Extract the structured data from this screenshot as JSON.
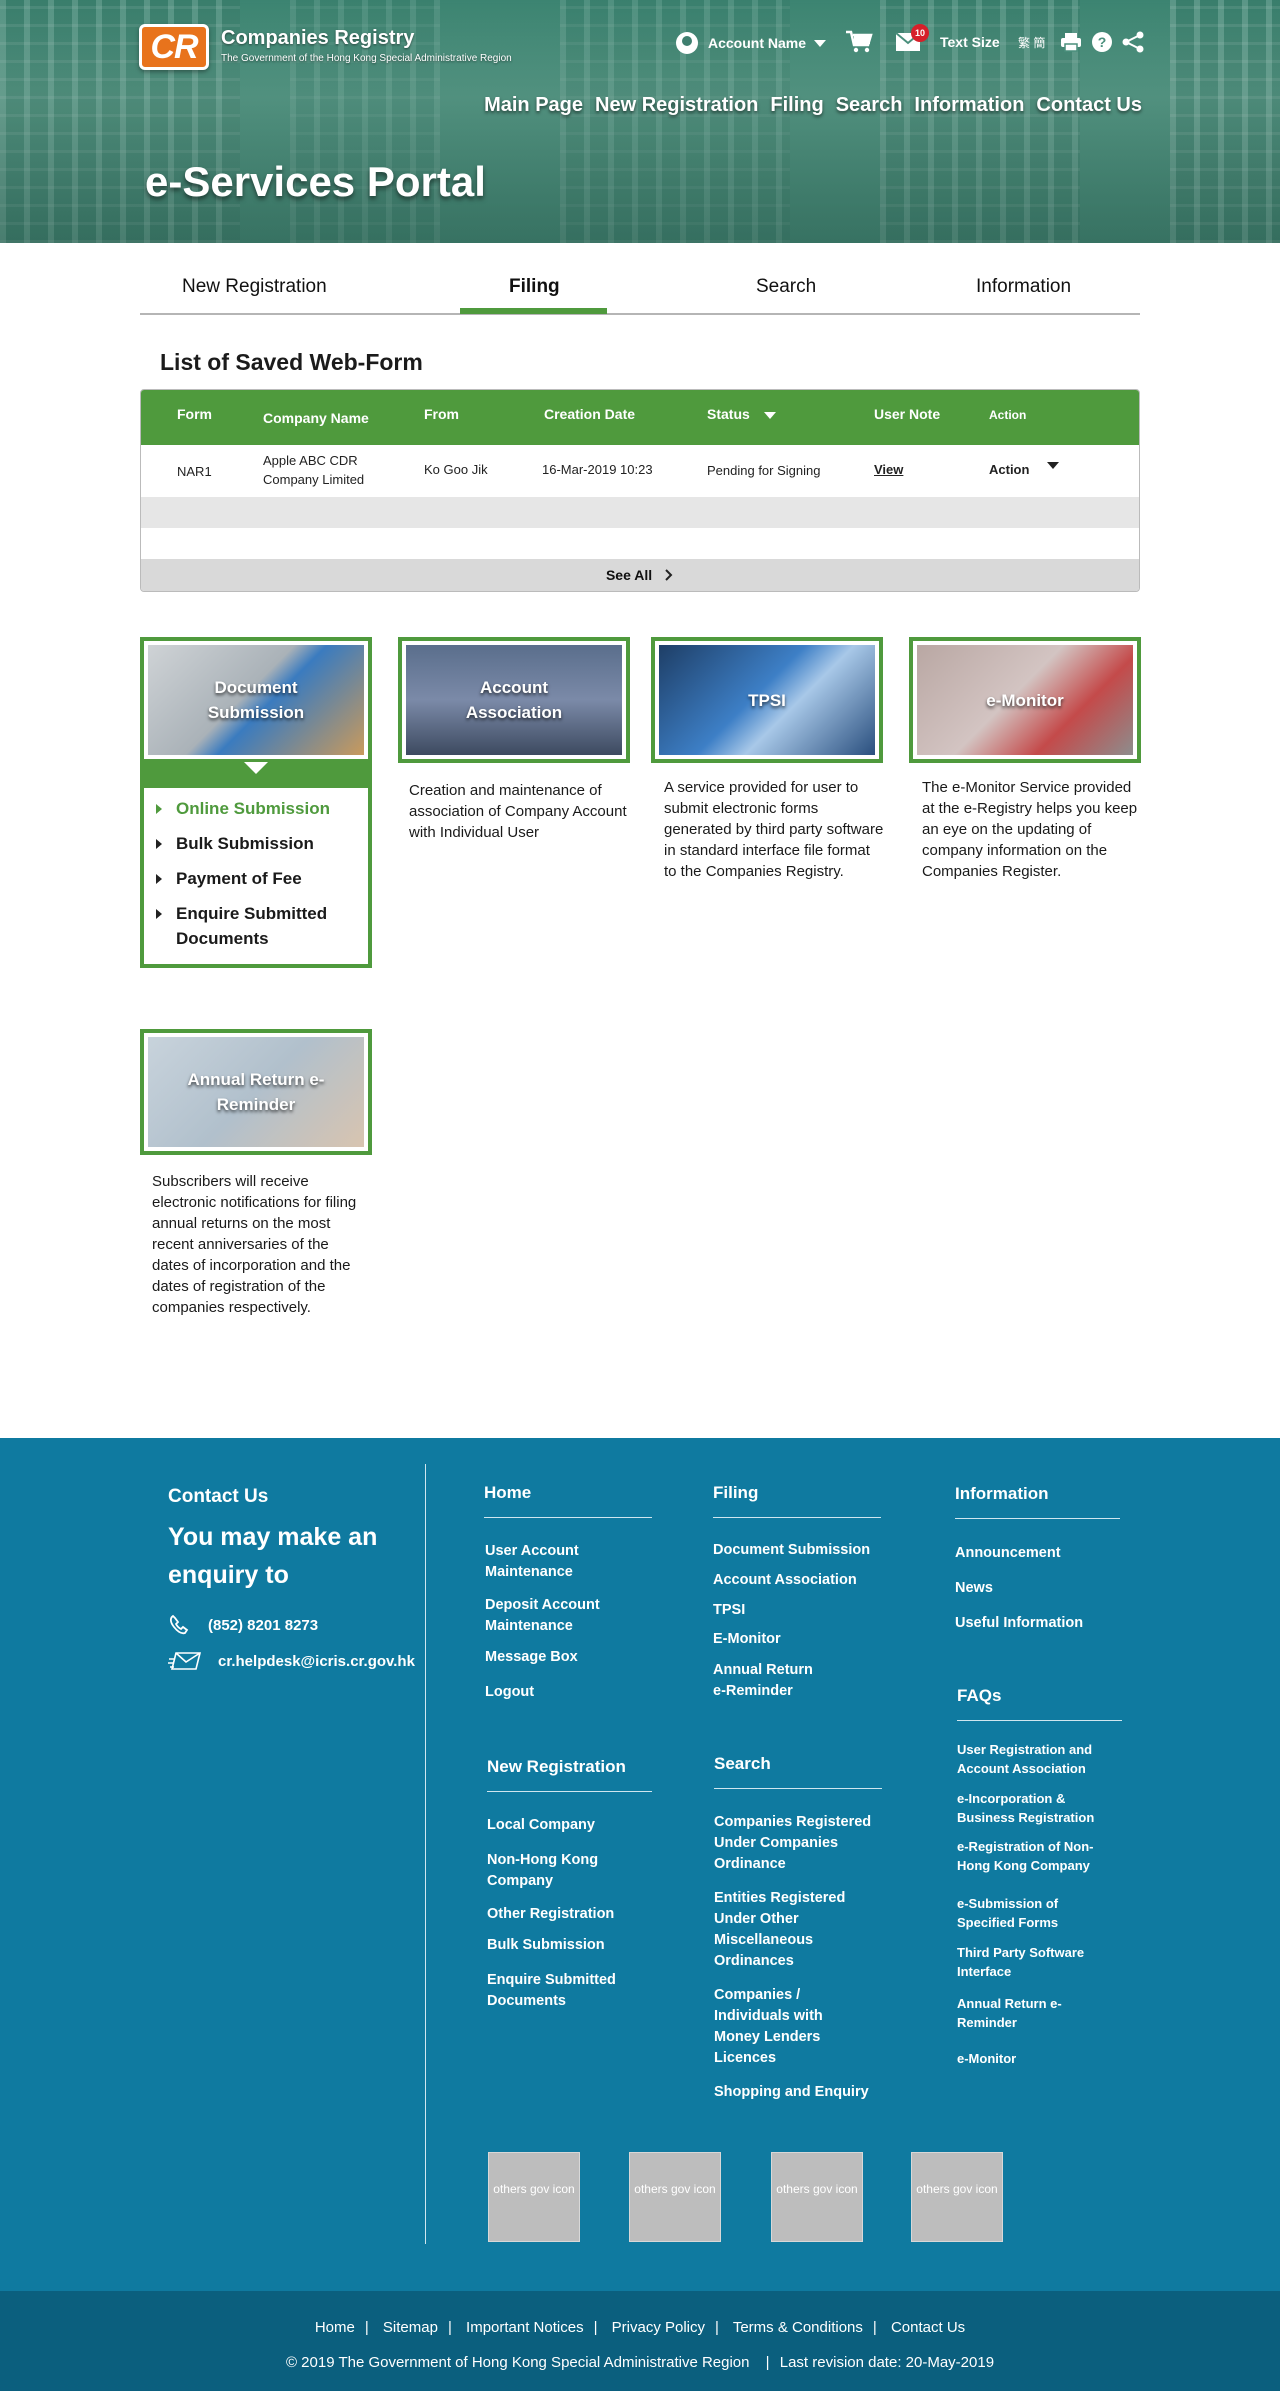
{
  "header": {
    "logo_mark": "CR",
    "org_name": "Companies Registry",
    "org_sub": "The Government of the Hong Kong Special Administrative Region",
    "account_name": "Account Name",
    "msg_count": "10",
    "text_size_label": "Text Size",
    "lang_label": "繁 簡",
    "page_title": "e-Services Portal"
  },
  "main_nav": [
    "Main Page",
    "New Registration",
    "Filing",
    "Search",
    "Information",
    "Contact Us"
  ],
  "tabs": {
    "items": [
      "New Registration",
      "Filing",
      "Search",
      "Information"
    ],
    "active": "Filing"
  },
  "saved_forms": {
    "title": "List of Saved Web-Form",
    "columns": [
      "Form",
      "Company Name",
      "From",
      "Creation Date",
      "Status",
      "User Note",
      "Action"
    ],
    "rows": [
      {
        "form": "NAR1",
        "company": "Apple ABC CDR Company Limited",
        "from": "Ko Goo Jik",
        "created": "16-Mar-2019 10:23",
        "status": "Pending for Signing",
        "note": "View",
        "action": "Action"
      }
    ],
    "see_all": "See All"
  },
  "services": {
    "doc_submission": {
      "title": "Document Submission",
      "menu": [
        "Online Submission",
        "Bulk Submission",
        "Payment of Fee",
        "Enquire Submitted Documents"
      ],
      "active_index": 0
    },
    "account_association": {
      "title": "Account Association",
      "desc": "Creation and maintenance of association of Company Account with Individual User"
    },
    "tpsi": {
      "title": "TPSI",
      "desc": "A service provided for user to submit electronic forms generated by third party software in standard interface file format to the Companies Registry."
    },
    "emonitor": {
      "title": "e-Monitor",
      "desc": "The e-Monitor Service provided at the e-Registry helps you keep an eye on the updating of company information on the Companies Register."
    },
    "annual_return": {
      "title": "Annual Return e-Reminder",
      "desc": "Subscribers  will receive electronic notifications for filing annual returns on the most recent anniversaries of the dates of incorporation and the dates of registration of the companies respectively."
    }
  },
  "footer": {
    "contact_heading": "Contact Us",
    "enquiry_text": "You may make an enquiry to",
    "phone": "(852) 8201 8273",
    "email": "cr.helpdesk@icris.cr.gov.hk",
    "home": {
      "heading": "Home",
      "links": [
        "User Account Maintenance",
        "Deposit Account Maintenance",
        "Message Box",
        "Logout"
      ]
    },
    "filing": {
      "heading": "Filing",
      "links": [
        "Document Submission",
        "Account Association",
        "TPSI",
        "E-Monitor",
        "Annual Return e-Reminder"
      ]
    },
    "information": {
      "heading": "Information",
      "links": [
        "Announcement",
        "News",
        "Useful Information"
      ]
    },
    "new_registration": {
      "heading": "New Registration",
      "links": [
        "Local Company",
        "Non-Hong Kong Company",
        "Other Registration",
        "Bulk Submission",
        "Enquire Submitted Documents"
      ]
    },
    "search": {
      "heading": "Search",
      "links": [
        "Companies Registered Under Companies Ordinance",
        "Entities Registered Under Other Miscellaneous Ordinances",
        "Companies / Individuals with Money Lenders Licences",
        "Shopping and Enquiry"
      ]
    },
    "faqs": {
      "heading": "FAQs",
      "links": [
        "User Registration and Account Association",
        "e-Incorporation & Business Registration",
        "e-Registration of Non-Hong Kong Company",
        "e-Submission of Specified Forms",
        "Third Party Software Interface",
        "Annual Return e-Reminder",
        "e-Monitor"
      ]
    },
    "gov_icons": [
      "others gov icon",
      "others gov icon",
      "others gov icon",
      "others gov icon"
    ],
    "bottom_links": [
      "Home",
      "Sitemap",
      "Important Notices",
      "Privacy Policy",
      "Terms & Conditions",
      "Contact Us"
    ],
    "copyright": "© 2019 The Government of Hong Kong Special Administrative Region",
    "revision": "Last revision date: 20-May-2019"
  },
  "colors": {
    "accent_green": "#4f9a3d",
    "footer_blue": "#0f7aa0",
    "footer_dark": "#0b5f7e",
    "logo_orange": "#e8731c"
  }
}
